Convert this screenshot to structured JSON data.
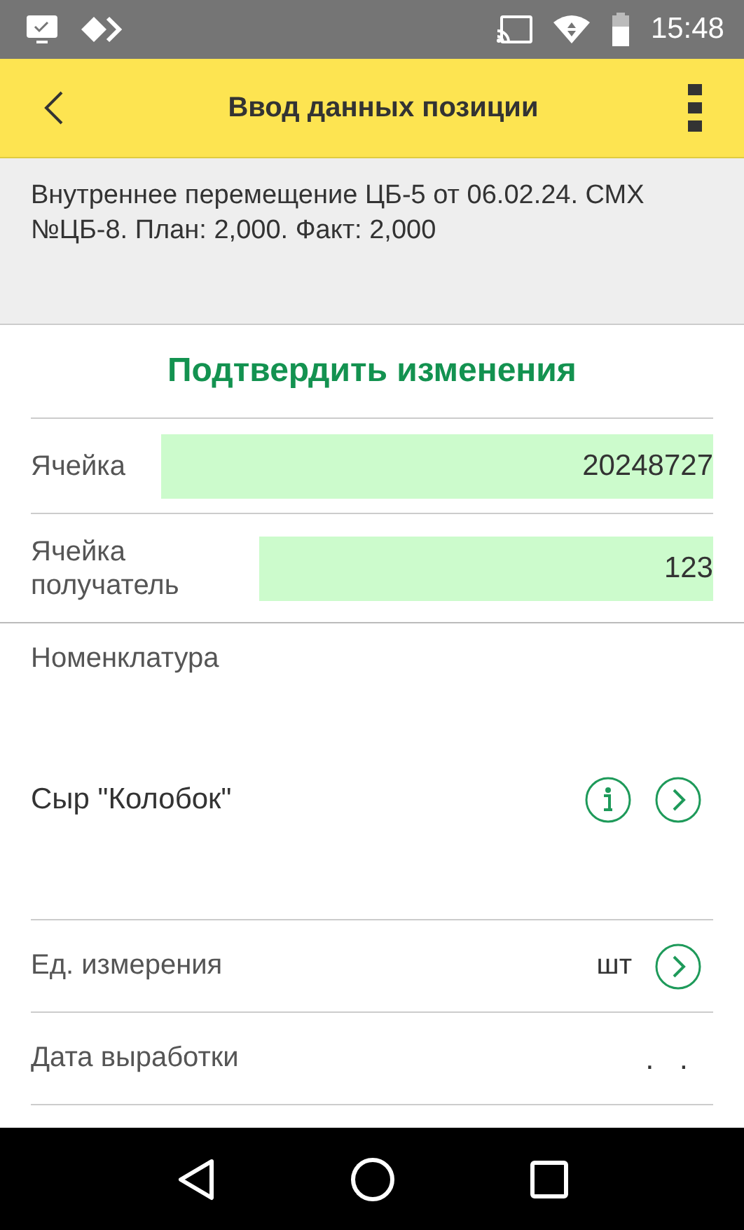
{
  "status_bar": {
    "time": "15:48"
  },
  "toolbar": {
    "title": "Ввод данных позиции"
  },
  "info": "Внутреннее перемещение ЦБ-5 от 06.02.24. СМХ №ЦБ-8. План: 2,000. Факт: 2,000",
  "confirm_button": "Подтвердить изменения",
  "cells": [
    {
      "label": "Ячейка",
      "value": "20248727"
    },
    {
      "label": "Ячейка получатель",
      "value": "123"
    }
  ],
  "nomenclature": {
    "label": "Номенклатура",
    "value": "Сыр \"Колобок\""
  },
  "unit": {
    "label": "Ед. измерения",
    "value": "шт"
  },
  "production_date": {
    "label": "Дата выработки",
    "value": ". ."
  }
}
